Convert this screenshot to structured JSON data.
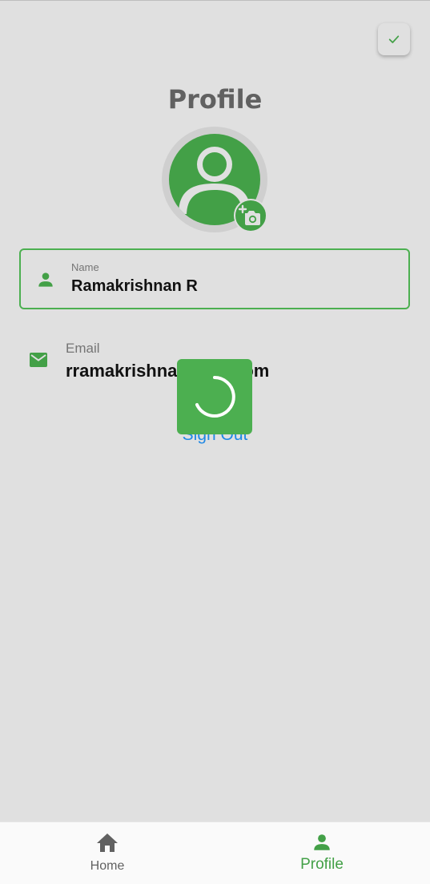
{
  "header": {
    "title": "Profile",
    "save_icon": "check-icon"
  },
  "avatar": {
    "icon": "account-circle-icon",
    "camera_icon": "add-a-photo-icon"
  },
  "name_field": {
    "label": "Name",
    "value": "Ramakrishnan R",
    "icon": "person-icon"
  },
  "email": {
    "label": "Email",
    "value": "rramakrishna  gmail.com",
    "icon": "mail-icon"
  },
  "sign_out": {
    "label": "Sign Out"
  },
  "loading": {
    "icon": "spinner-icon"
  },
  "bottom_nav": {
    "items": [
      {
        "label": "Home",
        "icon": "home-icon",
        "active": false
      },
      {
        "label": "Profile",
        "icon": "person-icon",
        "active": true
      }
    ]
  },
  "colors": {
    "accent": "#43a047",
    "background": "#e0e0e0",
    "link": "#1e88e5",
    "loader": "#4caf50"
  }
}
